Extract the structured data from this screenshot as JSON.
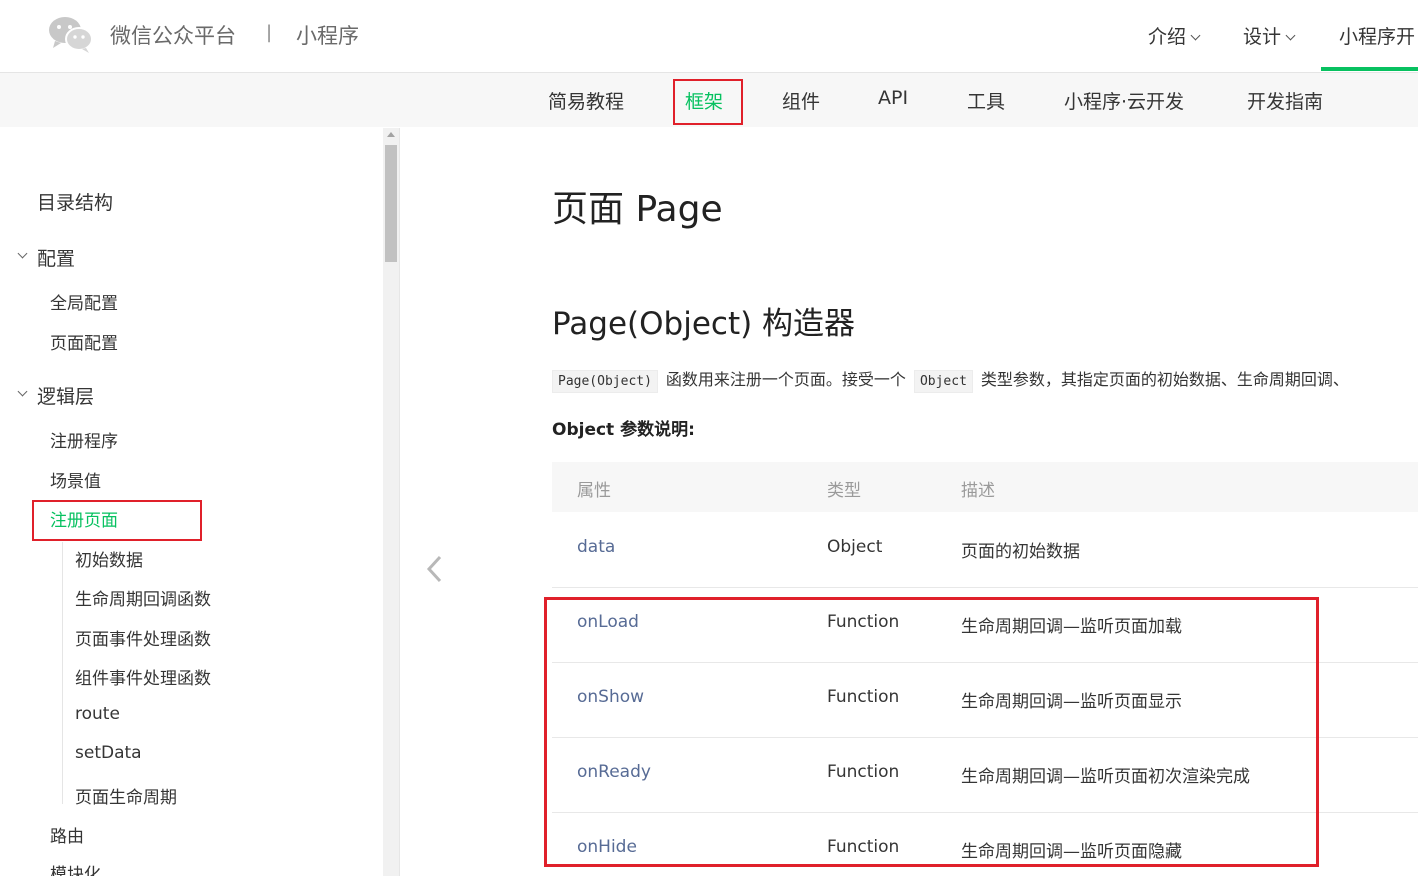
{
  "header": {
    "brand": "微信公众平台",
    "separator": "|",
    "sub": "小程序",
    "nav": [
      {
        "label": "介绍"
      },
      {
        "label": "设计"
      },
      {
        "label": "小程序开"
      }
    ]
  },
  "subnav": {
    "items": [
      "简易教程",
      "框架",
      "组件",
      "API",
      "工具",
      "小程序·云开发",
      "开发指南"
    ],
    "active": "框架"
  },
  "sidebar": {
    "title": "目录结构",
    "groups": [
      {
        "label": "配置",
        "children": [
          "全局配置",
          "页面配置"
        ]
      },
      {
        "label": "逻辑层",
        "children": [
          "注册程序",
          "场景值",
          "注册页面"
        ]
      }
    ],
    "active": "注册页面",
    "sub_items": [
      "初始数据",
      "生命周期回调函数",
      "页面事件处理函数",
      "组件事件处理函数",
      "route",
      "setData",
      "页面生命周期"
    ],
    "more": [
      "路由",
      "模块化"
    ]
  },
  "content": {
    "title": "页面 Page",
    "section_title": "Page(Object) 构造器",
    "para_code1": "Page(Object)",
    "para_text1": "函数用来注册一个页面。接受一个",
    "para_code2": "Object",
    "para_text2": "类型参数，其指定页面的初始数据、生命周期回调、",
    "params_heading": "Object 参数说明:",
    "table": {
      "headers": [
        "属性",
        "类型",
        "描述"
      ],
      "rows": [
        {
          "name": "data",
          "type": "Object",
          "desc": "页面的初始数据"
        },
        {
          "name": "onLoad",
          "type": "Function",
          "desc": "生命周期回调—监听页面加载"
        },
        {
          "name": "onShow",
          "type": "Function",
          "desc": "生命周期回调—监听页面显示"
        },
        {
          "name": "onReady",
          "type": "Function",
          "desc": "生命周期回调—监听页面初次渲染完成"
        },
        {
          "name": "onHide",
          "type": "Function",
          "desc": "生命周期回调—监听页面隐藏"
        }
      ]
    }
  },
  "icons": {
    "logo": "wechat-logo-icon",
    "nav_dropdown": "chevron-down-icon",
    "prev_page": "chevron-left-icon",
    "scroll_up": "scroll-up-arrow-icon"
  },
  "colors": {
    "accent": "#07c160",
    "link": "#576b95",
    "highlight_box": "#e0202a"
  }
}
